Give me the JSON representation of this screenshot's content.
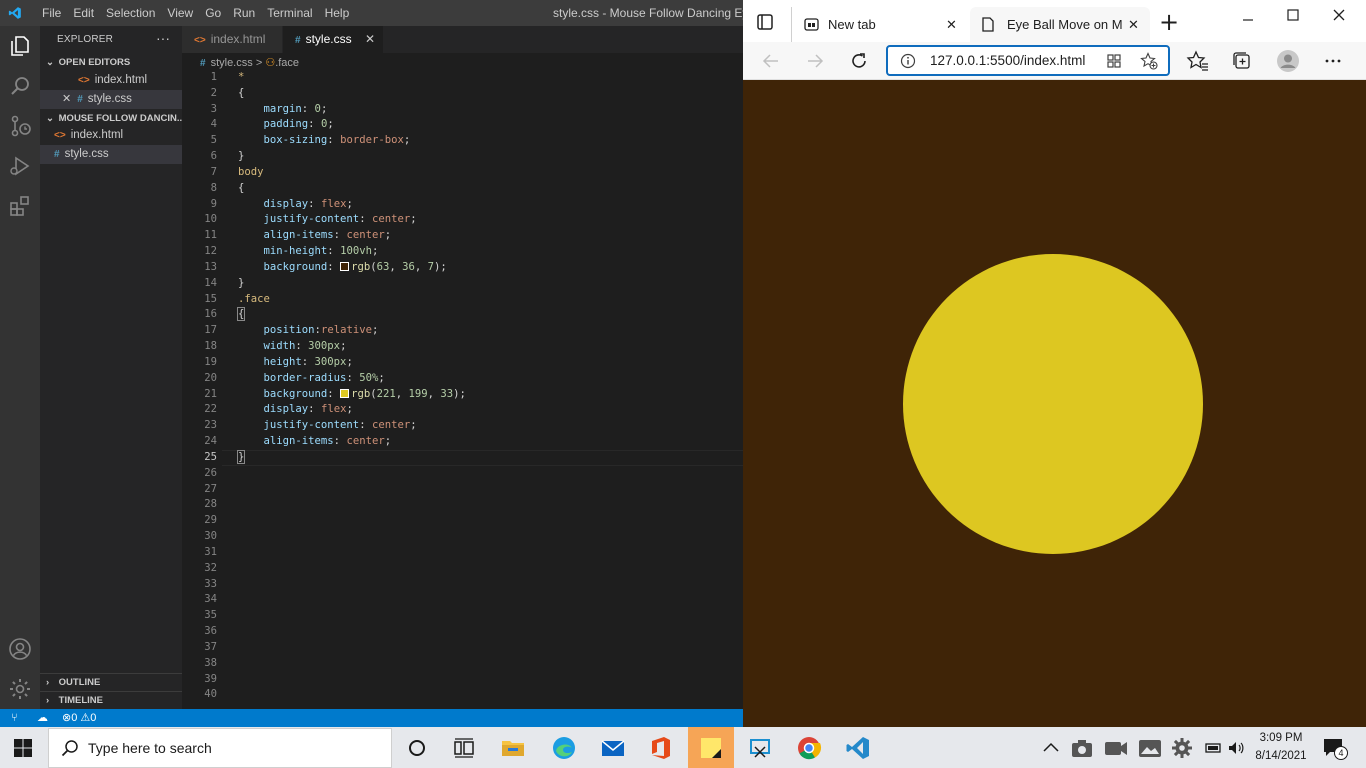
{
  "vscode": {
    "menu": [
      "File",
      "Edit",
      "Selection",
      "View",
      "Go",
      "Run",
      "Terminal",
      "Help"
    ],
    "window_title": "style.css - Mouse Follow Dancing Eyes - Vis",
    "explorer_title": "EXPLORER",
    "explorer_more": "···",
    "open_editors_label": "OPEN EDITORS",
    "open_editors": [
      {
        "name": "index.html",
        "type": "html"
      },
      {
        "name": "style.css",
        "type": "css"
      }
    ],
    "project_label": "MOUSE FOLLOW DANCIN...",
    "project_files": [
      {
        "name": "index.html",
        "type": "html"
      },
      {
        "name": "style.css",
        "type": "css"
      }
    ],
    "outline_label": "OUTLINE",
    "timeline_label": "TIMELINE",
    "tabs": [
      {
        "label": "index.html",
        "icon": "<>"
      },
      {
        "label": "style.css",
        "icon": "#",
        "close": "✕"
      }
    ],
    "breadcrumb": {
      "file": "style.css",
      "sep": ">",
      "symbol": ".face"
    },
    "code_lines": [
      "*",
      "{",
      "    margin: 0;",
      "    padding: 0;",
      "    box-sizing: border-box;",
      "}",
      "body",
      "{",
      "    display: flex;",
      "    justify-content: center;",
      "    align-items: center;",
      "    min-height: 100vh;",
      "    background: rgb(63, 36, 7);",
      "}",
      ".face",
      "{",
      "    position:relative;",
      "    width: 300px;",
      "    height: 300px;",
      "    border-radius: 50%;",
      "    background: rgb(221, 199, 33);",
      "    display: flex;",
      "    justify-content: center;",
      "    align-items: center;",
      "}",
      "",
      "",
      "",
      "",
      "",
      "",
      "",
      "",
      "",
      "",
      "",
      "",
      "",
      "",
      ""
    ],
    "line_count": 40,
    "current_line": 25,
    "status": {
      "errors": "0",
      "warnings": "0"
    }
  },
  "browser": {
    "tabs": [
      {
        "label": "New tab"
      },
      {
        "label": "Eye Ball Move on Mo"
      }
    ],
    "close_glyph": "✕",
    "new_tab_glyph": "+",
    "url": "127.0.0.1:5500/index.html",
    "page_bg": "#3f2407",
    "face_color": "#ddc721"
  },
  "taskbar": {
    "search_placeholder": "Type here to search",
    "time": "3:09 PM",
    "date": "8/14/2021",
    "notification_count": "4"
  },
  "colors": {
    "vscode_accent": "#007acc",
    "edge_accent": "#0f6cbd"
  }
}
